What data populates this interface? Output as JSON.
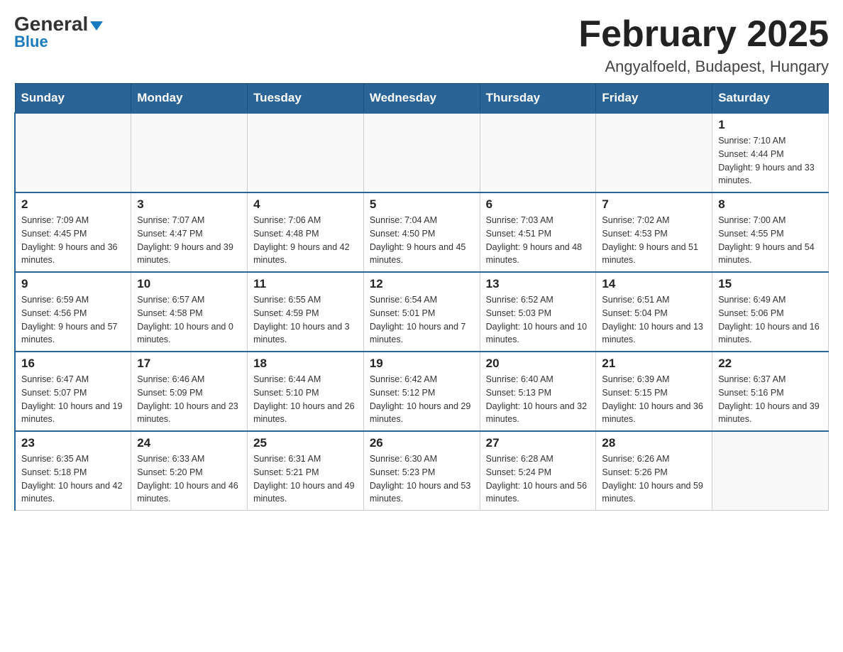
{
  "logo": {
    "general": "General",
    "blue": "Blue",
    "triangle": "▼"
  },
  "header": {
    "title": "February 2025",
    "location": "Angyalfoeld, Budapest, Hungary"
  },
  "days_of_week": [
    "Sunday",
    "Monday",
    "Tuesday",
    "Wednesday",
    "Thursday",
    "Friday",
    "Saturday"
  ],
  "weeks": [
    [
      {
        "day": "",
        "info": ""
      },
      {
        "day": "",
        "info": ""
      },
      {
        "day": "",
        "info": ""
      },
      {
        "day": "",
        "info": ""
      },
      {
        "day": "",
        "info": ""
      },
      {
        "day": "",
        "info": ""
      },
      {
        "day": "1",
        "info": "Sunrise: 7:10 AM\nSunset: 4:44 PM\nDaylight: 9 hours and 33 minutes."
      }
    ],
    [
      {
        "day": "2",
        "info": "Sunrise: 7:09 AM\nSunset: 4:45 PM\nDaylight: 9 hours and 36 minutes."
      },
      {
        "day": "3",
        "info": "Sunrise: 7:07 AM\nSunset: 4:47 PM\nDaylight: 9 hours and 39 minutes."
      },
      {
        "day": "4",
        "info": "Sunrise: 7:06 AM\nSunset: 4:48 PM\nDaylight: 9 hours and 42 minutes."
      },
      {
        "day": "5",
        "info": "Sunrise: 7:04 AM\nSunset: 4:50 PM\nDaylight: 9 hours and 45 minutes."
      },
      {
        "day": "6",
        "info": "Sunrise: 7:03 AM\nSunset: 4:51 PM\nDaylight: 9 hours and 48 minutes."
      },
      {
        "day": "7",
        "info": "Sunrise: 7:02 AM\nSunset: 4:53 PM\nDaylight: 9 hours and 51 minutes."
      },
      {
        "day": "8",
        "info": "Sunrise: 7:00 AM\nSunset: 4:55 PM\nDaylight: 9 hours and 54 minutes."
      }
    ],
    [
      {
        "day": "9",
        "info": "Sunrise: 6:59 AM\nSunset: 4:56 PM\nDaylight: 9 hours and 57 minutes."
      },
      {
        "day": "10",
        "info": "Sunrise: 6:57 AM\nSunset: 4:58 PM\nDaylight: 10 hours and 0 minutes."
      },
      {
        "day": "11",
        "info": "Sunrise: 6:55 AM\nSunset: 4:59 PM\nDaylight: 10 hours and 3 minutes."
      },
      {
        "day": "12",
        "info": "Sunrise: 6:54 AM\nSunset: 5:01 PM\nDaylight: 10 hours and 7 minutes."
      },
      {
        "day": "13",
        "info": "Sunrise: 6:52 AM\nSunset: 5:03 PM\nDaylight: 10 hours and 10 minutes."
      },
      {
        "day": "14",
        "info": "Sunrise: 6:51 AM\nSunset: 5:04 PM\nDaylight: 10 hours and 13 minutes."
      },
      {
        "day": "15",
        "info": "Sunrise: 6:49 AM\nSunset: 5:06 PM\nDaylight: 10 hours and 16 minutes."
      }
    ],
    [
      {
        "day": "16",
        "info": "Sunrise: 6:47 AM\nSunset: 5:07 PM\nDaylight: 10 hours and 19 minutes."
      },
      {
        "day": "17",
        "info": "Sunrise: 6:46 AM\nSunset: 5:09 PM\nDaylight: 10 hours and 23 minutes."
      },
      {
        "day": "18",
        "info": "Sunrise: 6:44 AM\nSunset: 5:10 PM\nDaylight: 10 hours and 26 minutes."
      },
      {
        "day": "19",
        "info": "Sunrise: 6:42 AM\nSunset: 5:12 PM\nDaylight: 10 hours and 29 minutes."
      },
      {
        "day": "20",
        "info": "Sunrise: 6:40 AM\nSunset: 5:13 PM\nDaylight: 10 hours and 32 minutes."
      },
      {
        "day": "21",
        "info": "Sunrise: 6:39 AM\nSunset: 5:15 PM\nDaylight: 10 hours and 36 minutes."
      },
      {
        "day": "22",
        "info": "Sunrise: 6:37 AM\nSunset: 5:16 PM\nDaylight: 10 hours and 39 minutes."
      }
    ],
    [
      {
        "day": "23",
        "info": "Sunrise: 6:35 AM\nSunset: 5:18 PM\nDaylight: 10 hours and 42 minutes."
      },
      {
        "day": "24",
        "info": "Sunrise: 6:33 AM\nSunset: 5:20 PM\nDaylight: 10 hours and 46 minutes."
      },
      {
        "day": "25",
        "info": "Sunrise: 6:31 AM\nSunset: 5:21 PM\nDaylight: 10 hours and 49 minutes."
      },
      {
        "day": "26",
        "info": "Sunrise: 6:30 AM\nSunset: 5:23 PM\nDaylight: 10 hours and 53 minutes."
      },
      {
        "day": "27",
        "info": "Sunrise: 6:28 AM\nSunset: 5:24 PM\nDaylight: 10 hours and 56 minutes."
      },
      {
        "day": "28",
        "info": "Sunrise: 6:26 AM\nSunset: 5:26 PM\nDaylight: 10 hours and 59 minutes."
      },
      {
        "day": "",
        "info": ""
      }
    ]
  ]
}
